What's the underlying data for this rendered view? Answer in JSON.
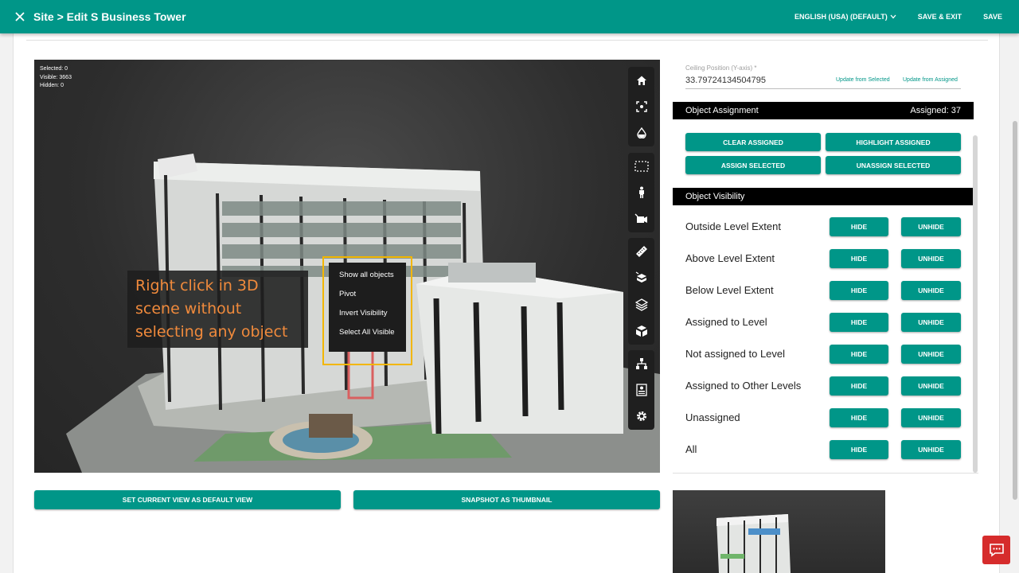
{
  "header": {
    "title": "Site > Edit S Business Tower",
    "language": "ENGLISH (USA) (DEFAULT)",
    "save_exit": "SAVE & EXIT",
    "save": "SAVE"
  },
  "viewer": {
    "stats": {
      "selected": "Selected: 0",
      "visible": "Visible: 3663",
      "hidden": "Hidden: 0"
    },
    "annotation": "Right click in 3D scene without selecting any object",
    "context_menu": [
      "Show all objects",
      "Pivot",
      "Invert Visibility",
      "Select All Visible"
    ],
    "toolbar_icons": [
      "home-icon",
      "focus-icon",
      "water-drop-icon",
      "select-box-icon",
      "person-icon",
      "camera-icon",
      "ruler-icon",
      "cube-section-icon",
      "layers-icon",
      "exploded-cube-icon",
      "hierarchy-icon",
      "properties-icon",
      "settings-icon"
    ]
  },
  "bottom_buttons": {
    "default_view": "SET CURRENT VIEW AS DEFAULT VIEW",
    "snapshot": "SNAPSHOT AS THUMBNAIL"
  },
  "panel": {
    "ceiling_label": "Ceiling Position (Y-axis) *",
    "ceiling_value": "33.79724134504795",
    "update_from_selected": "Update from Selected",
    "update_from_assigned": "Update from Assigned",
    "assignment": {
      "title": "Object Assignment",
      "assigned": "Assigned: 37",
      "clear": "CLEAR ASSIGNED",
      "highlight": "HIGHLIGHT ASSIGNED",
      "assign": "ASSIGN SELECTED",
      "unassign": "UNASSIGN SELECTED"
    },
    "visibility": {
      "title": "Object Visibility",
      "hide": "HIDE",
      "unhide": "UNHIDE",
      "rows": [
        "Outside Level Extent",
        "Above Level Extent",
        "Below Level Extent",
        "Assigned to Level",
        "Not assigned to Level",
        "Assigned to Other Levels",
        "Unassigned",
        "All"
      ]
    }
  },
  "colors": {
    "primary": "#009688",
    "annotation": "#f08a3c",
    "highlight_frame": "#f2b600",
    "chat": "#d62c2c"
  }
}
